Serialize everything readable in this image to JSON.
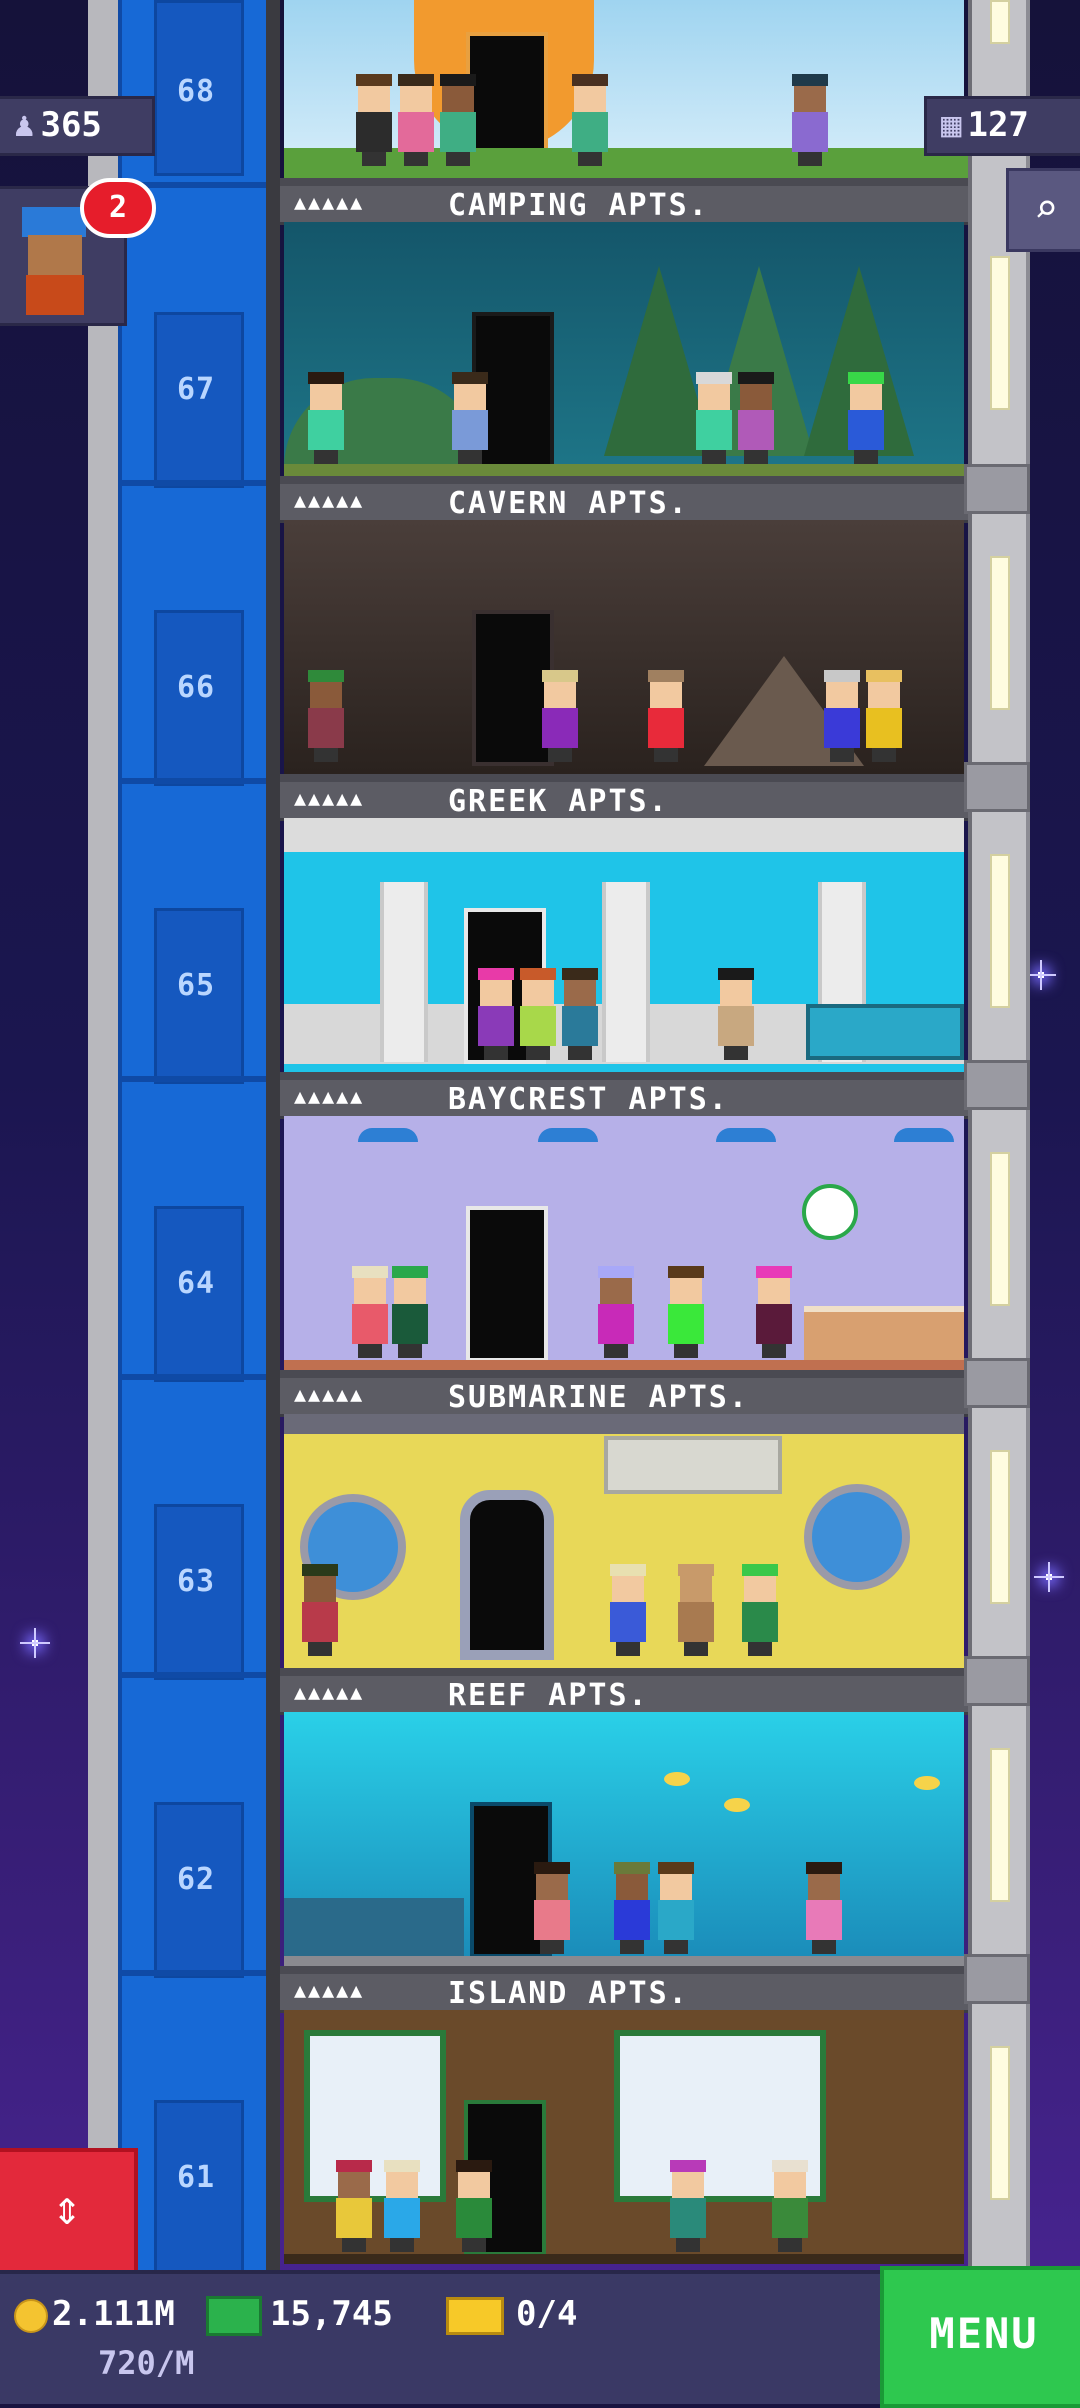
{
  "hud": {
    "population": "365",
    "floor_count": "127",
    "visitor_badge": "2",
    "search_icon": "magnifier-icon",
    "elevator_icon": "up-down-arrows-icon"
  },
  "tower": {
    "top_floor_number": "68",
    "floors": [
      {
        "number": "67",
        "name": "CAMPING APTS.",
        "stars": "▲▲▲▲▲"
      },
      {
        "number": "66",
        "name": "CAVERN APTS.",
        "stars": "▲▲▲▲▲"
      },
      {
        "number": "65",
        "name": "GREEK APTS.",
        "stars": "▲▲▲▲▲"
      },
      {
        "number": "64",
        "name": "BAYCREST APTS.",
        "stars": "▲▲▲▲▲"
      },
      {
        "number": "63",
        "name": "SUBMARINE APTS.",
        "stars": "▲▲▲▲▲"
      },
      {
        "number": "62",
        "name": "REEF APTS.",
        "stars": "▲▲▲▲▲"
      },
      {
        "number": "61",
        "name": "ISLAND APTS.",
        "stars": "▲▲▲▲▲"
      }
    ]
  },
  "bottom_bar": {
    "coins": "2.111M",
    "coin_rate": "720/M",
    "bux": "15,745",
    "tickets": "0/4",
    "menu_label": "MENU"
  },
  "colors": {
    "elevator": "#1769d6",
    "menu": "#2ec84f",
    "elevator_button": "#e3293b"
  }
}
